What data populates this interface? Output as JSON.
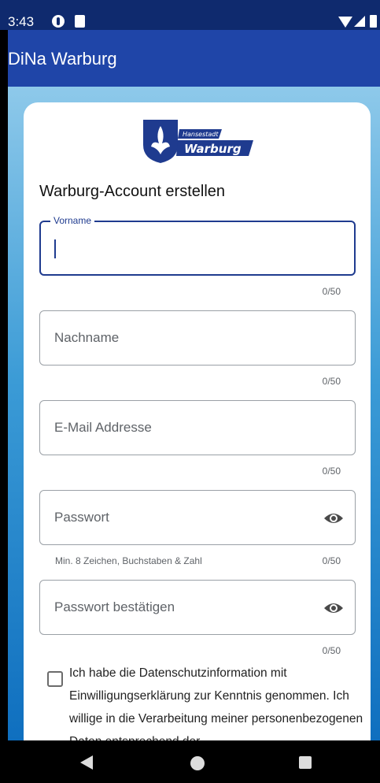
{
  "status_bar": {
    "time": "3:43",
    "icons": [
      "app-notification-icon",
      "sd-card-icon",
      "wifi-icon",
      "signal-icon",
      "battery-icon"
    ]
  },
  "app_bar": {
    "title": "DiNa Warburg"
  },
  "form": {
    "logo": {
      "small_text": "Hansestadt",
      "big_text": "Warburg",
      "brand_color": "#1f3b8f"
    },
    "heading": "Warburg-Account erstellen",
    "fields": {
      "first_name": {
        "label": "Vorname",
        "counter": "0/50"
      },
      "last_name": {
        "placeholder": "Nachname",
        "counter": "0/50"
      },
      "email": {
        "placeholder": "E-Mail Addresse",
        "counter": "0/50"
      },
      "password": {
        "placeholder": "Passwort",
        "hint": "Min. 8 Zeichen, Buchstaben & Zahl",
        "counter": "0/50"
      },
      "password_confirm": {
        "placeholder": "Passwort bestätigen",
        "counter": "0/50"
      }
    },
    "consent_text": "Ich habe die Datenschutzinformation mit Einwilligungserklärung zur Kenntnis genommen. Ich willige in die Verarbeitung meiner personenbezogenen Daten entsprechend der"
  },
  "colors": {
    "status_bar": "#0f2a6e",
    "app_bar": "#1f45a8",
    "accent": "#1f3b8f"
  }
}
